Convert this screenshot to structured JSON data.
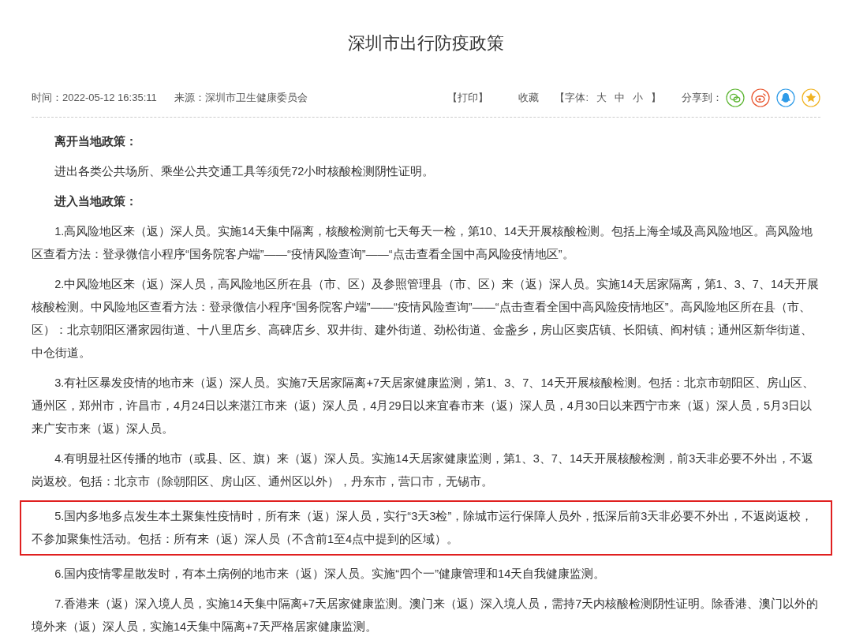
{
  "title": "深圳市出行防疫政策",
  "meta": {
    "time": "时间：2022-05-12 16:35:11",
    "source": "来源：深圳市卫生健康委员会",
    "print": "【打印】",
    "favorite": "收藏",
    "font_label": "【字体:",
    "font_sizes": [
      "大",
      "中",
      "小"
    ],
    "font_close": "】",
    "share_label": "分享到："
  },
  "paragraphs": [
    {
      "kind": "heading",
      "text": "离开当地政策："
    },
    {
      "kind": "text",
      "text": "进出各类公共场所、乘坐公共交通工具等须凭72小时核酸检测阴性证明。"
    },
    {
      "kind": "heading",
      "text": "进入当地政策："
    },
    {
      "kind": "text",
      "text": "1.高风险地区来（返）深人员。实施14天集中隔离，核酸检测前七天每天一检，第10、14天开展核酸检测。包括上海全域及高风险地区。高风险地区查看方法：登录微信小程序“国务院客户端”——“疫情风险查询”——“点击查看全国中高风险疫情地区”。"
    },
    {
      "kind": "text",
      "text": "2.中风险地区来（返）深人员，高风险地区所在县（市、区）及参照管理县（市、区）来（返）深人员。实施14天居家隔离，第1、3、7、14天开展核酸检测。中风险地区查看方法：登录微信小程序“国务院客户端”——“疫情风险查询”——“点击查看全国中高风险疫情地区”。高风险地区所在县（市、区）：北京朝阳区潘家园街道、十八里店乡、高碑店乡、双井街、建外街道、劲松街道、金盏乡，房山区窦店镇、长阳镇、阎村镇；通州区新华街道、中仓街道。"
    },
    {
      "kind": "text",
      "text": "3.有社区暴发疫情的地市来（返）深人员。实施7天居家隔离+7天居家健康监测，第1、3、7、14天开展核酸检测。包括：北京市朝阳区、房山区、通州区，郑州市，许昌市，4月24日以来湛江市来（返）深人员，4月29日以来宜春市来（返）深人员，4月30日以来西宁市来（返）深人员，5月3日以来广安市来（返）深人员。"
    },
    {
      "kind": "text",
      "text": "4.有明显社区传播的地市（或县、区、旗）来（返）深人员。实施14天居家健康监测，第1、3、7、14天开展核酸检测，前3天非必要不外出，不返岗返校。包括：北京市（除朝阳区、房山区、通州区以外），丹东市，营口市，无锡市。"
    },
    {
      "kind": "highlighted",
      "text": "5.国内多地多点发生本土聚集性疫情时，所有来（返）深人员，实行“3天3检”，除城市运行保障人员外，抵深后前3天非必要不外出，不返岗返校，不参加聚集性活动。包括：所有来（返）深人员（不含前1至4点中提到的区域）。"
    },
    {
      "kind": "text",
      "text": "6.国内疫情零星散发时，有本土病例的地市来（返）深人员。实施“四个一”健康管理和14天自我健康监测。"
    },
    {
      "kind": "text",
      "text": "7.香港来（返）深入境人员，实施14天集中隔离+7天居家健康监测。澳门来（返）深入境人员，需持7天内核酸检测阴性证明。除香港、澳门以外的境外来（返）深人员，实施14天集中隔离+7天严格居家健康监测。"
    }
  ]
}
